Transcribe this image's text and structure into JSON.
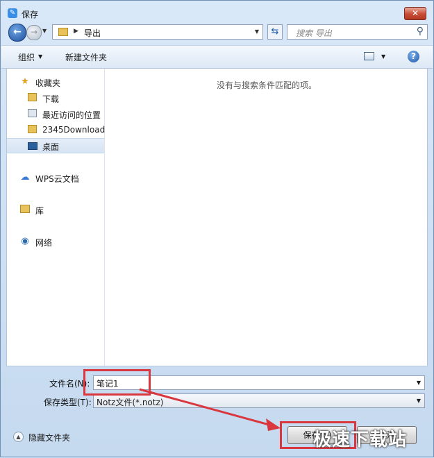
{
  "window": {
    "title": "保存",
    "close_icon": "✕"
  },
  "nav": {
    "back_icon": "back-arrow-icon",
    "forward_icon": "forward-arrow-icon",
    "address_crumb": "导出",
    "search_placeholder": "搜索 导出"
  },
  "toolbar": {
    "organize_label": "组织",
    "new_folder_label": "新建文件夹"
  },
  "sidebar": {
    "items": [
      {
        "label": "收藏夹",
        "icon": "star-icon"
      },
      {
        "label": "下载",
        "icon": "download-folder-icon"
      },
      {
        "label": "最近访问的位置",
        "icon": "recent-places-icon"
      },
      {
        "label": "2345Download",
        "icon": "folder-icon"
      },
      {
        "label": "桌面",
        "icon": "desktop-icon"
      },
      {
        "label": "WPS云文档",
        "icon": "cloud-icon"
      },
      {
        "label": "库",
        "icon": "library-icon"
      },
      {
        "label": "网络",
        "icon": "network-icon"
      }
    ]
  },
  "main": {
    "empty_message": "没有与搜索条件匹配的项。"
  },
  "form": {
    "filename_label": "文件名(N):",
    "filename_value": "笔记1",
    "filetype_label": "保存类型(T):",
    "filetype_value": "Notz文件(*.notz)"
  },
  "footer": {
    "hide_folders_label": "隐藏文件夹",
    "save_label": "保存(S)",
    "cancel_label": "取消"
  },
  "watermark": "极速下载站",
  "colors": {
    "highlight_box": "#d9363e",
    "accent": "#1f57a6"
  }
}
